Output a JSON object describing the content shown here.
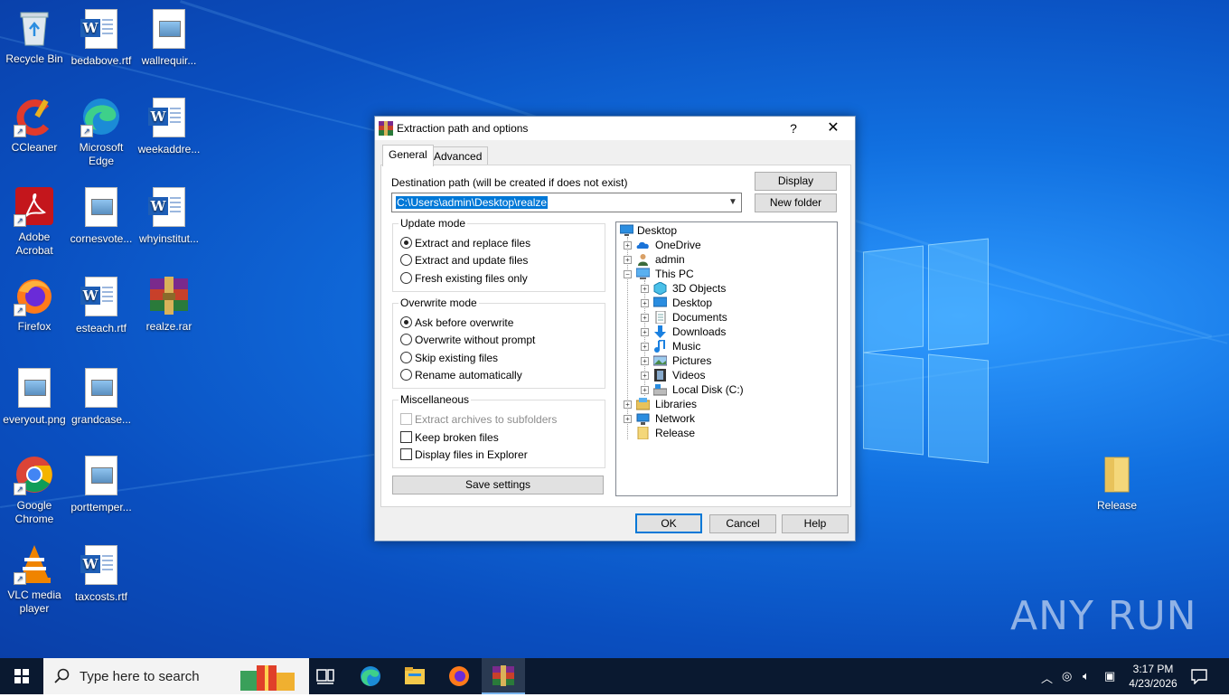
{
  "desktop": {
    "icons": [
      {
        "label": "Recycle Bin"
      },
      {
        "label": "bedabove.rtf"
      },
      {
        "label": "wallrequir..."
      },
      {
        "label": "CCleaner"
      },
      {
        "label": "Microsoft Edge"
      },
      {
        "label": "weekaddre..."
      },
      {
        "label": "Adobe Acrobat"
      },
      {
        "label": "cornesvote..."
      },
      {
        "label": "whyinstitut..."
      },
      {
        "label": "Firefox"
      },
      {
        "label": "esteach.rtf"
      },
      {
        "label": "realze.rar"
      },
      {
        "label": "everyout.png"
      },
      {
        "label": "grandcase..."
      },
      {
        "label": "Google Chrome"
      },
      {
        "label": "porttemper..."
      },
      {
        "label": "VLC media player"
      },
      {
        "label": "taxcosts.rtf"
      },
      {
        "label": "Release"
      }
    ],
    "watermark": "ANY RUN"
  },
  "dialog": {
    "title": "Extraction path and options",
    "help": "?",
    "close": "✕",
    "tabs": [
      "General",
      "Advanced"
    ],
    "destination_label": "Destination path (will be created if does not exist)",
    "destination_value": "C:\\Users\\admin\\Desktop\\realze",
    "display_button": "Display",
    "new_folder_button": "New folder",
    "update_mode": {
      "title": "Update mode",
      "options": [
        "Extract and replace files",
        "Extract and update files",
        "Fresh existing files only"
      ],
      "selected": 0
    },
    "overwrite_mode": {
      "title": "Overwrite mode",
      "options": [
        "Ask before overwrite",
        "Overwrite without prompt",
        "Skip existing files",
        "Rename automatically"
      ],
      "selected": 0
    },
    "misc": {
      "title": "Miscellaneous",
      "options": [
        "Extract archives to subfolders",
        "Keep broken files",
        "Display files in Explorer"
      ]
    },
    "save_settings": "Save settings",
    "tree": [
      "Desktop",
      "OneDrive",
      "admin",
      "This PC",
      "3D Objects",
      "Desktop",
      "Documents",
      "Downloads",
      "Music",
      "Pictures",
      "Videos",
      "Local Disk (C:)",
      "Libraries",
      "Network",
      "Release"
    ],
    "ok": "OK",
    "cancel": "Cancel",
    "help_button": "Help"
  },
  "taskbar": {
    "search_placeholder": "Type here to search",
    "time": "3:17 PM",
    "date": "4/23/2026"
  },
  "colors": {
    "accent": "#0078d7",
    "taskbar": "#0a1930",
    "desktop": "#1170e0"
  }
}
